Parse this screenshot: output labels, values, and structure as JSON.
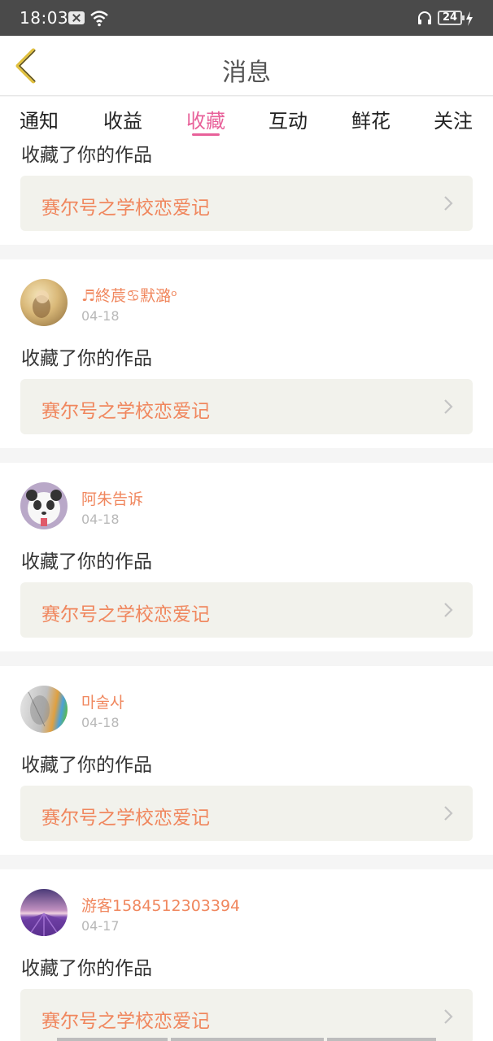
{
  "status_bar": {
    "time": "18:03",
    "battery": "24"
  },
  "header": {
    "title": "消息",
    "back_icon": "chevron-left-icon"
  },
  "tabs": [
    {
      "label": "通知",
      "active": false
    },
    {
      "label": "收益",
      "active": false
    },
    {
      "label": "收藏",
      "active": true
    },
    {
      "label": "互动",
      "active": false
    },
    {
      "label": "鲜花",
      "active": false
    },
    {
      "label": "关注",
      "active": false
    }
  ],
  "colors": {
    "accent": "#e8619a",
    "name": "#f0875e",
    "work": "#f0875e",
    "work_bg": "#f2f2ec"
  },
  "feed": {
    "partial_card": {
      "action": "收藏了你的作品",
      "work_title": "赛尔号之学校恋爱记"
    },
    "items": [
      {
        "username": "♬終莀♋默潞ᵒ",
        "date": "04-18",
        "action": "收藏了你的作品",
        "work_title": "赛尔号之学校恋爱记"
      },
      {
        "username": "阿朱告诉",
        "date": "04-18",
        "action": "收藏了你的作品",
        "work_title": "赛尔号之学校恋爱记"
      },
      {
        "username": "마술사",
        "date": "04-18",
        "action": "收藏了你的作品",
        "work_title": "赛尔号之学校恋爱记"
      },
      {
        "username": "游客1584512303394",
        "date": "04-17",
        "action": "收藏了你的作品",
        "work_title": "赛尔号之学校恋爱记"
      }
    ]
  }
}
